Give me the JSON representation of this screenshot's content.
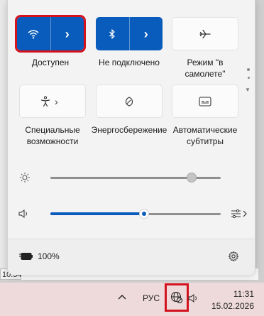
{
  "background": {
    "time_fragment": "10:34"
  },
  "quick_settings": {
    "tiles": [
      {
        "label": "Доступен",
        "icon": "wifi-icon",
        "state": "on"
      },
      {
        "label": "Не подключено",
        "icon": "bluetooth-icon",
        "state": "on"
      },
      {
        "label": "Режим \"в самолете\"",
        "icon": "airplane-icon",
        "state": "off"
      },
      {
        "label": "Специальные возможности",
        "icon": "accessibility-icon",
        "state": "off"
      },
      {
        "label": "Энергосбережение",
        "icon": "battery-saver-leaf-icon",
        "state": "off"
      },
      {
        "label": "Автоматические субтитры",
        "icon": "live-captions-icon",
        "state": "off"
      }
    ],
    "brightness": {
      "icon": "brightness-icon",
      "level_percent": 83
    },
    "volume": {
      "icon": "speaker-icon",
      "level_percent": 55,
      "output_icon": "audio-output-icon"
    },
    "battery": {
      "icon": "battery-charging-icon",
      "label": "100%"
    },
    "settings_icon": "gear-icon"
  },
  "taskbar": {
    "overflow_icon": "chevron-up-icon",
    "language": "РУС",
    "network_icon": "globe-no-internet-icon",
    "volume_icon": "speaker-icon",
    "time": "11:31",
    "date": "15.02.2026"
  },
  "colors": {
    "accent": "#0a5cbc",
    "highlight": "#d4121d"
  }
}
